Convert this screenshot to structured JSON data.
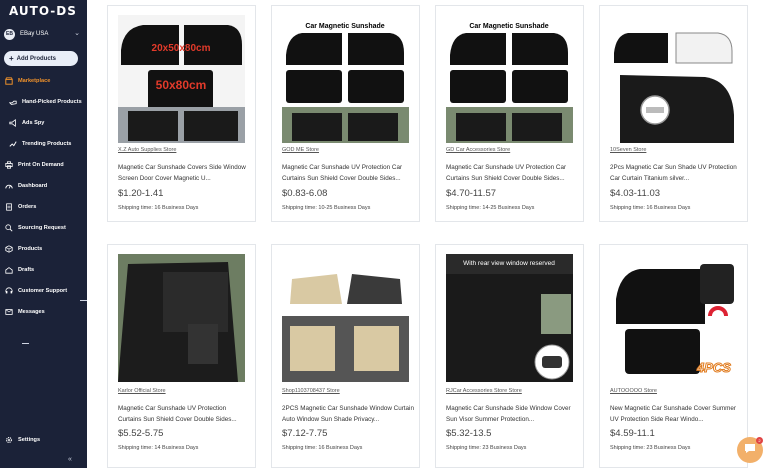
{
  "brand": {
    "logo": "AUTO-DS"
  },
  "store": {
    "badge": "EB",
    "name": "EBay USA"
  },
  "sidebar": {
    "add_products": "Add Products",
    "items": [
      {
        "label": "Marketplace",
        "icon": "store-icon",
        "active": true
      },
      {
        "label": "Hand-Picked Products",
        "icon": "hand-icon",
        "sub": true
      },
      {
        "label": "Ads Spy",
        "icon": "megaphone-icon",
        "sub": true
      },
      {
        "label": "Trending Products",
        "icon": "trend-icon",
        "sub": true
      },
      {
        "label": "Print On Demand",
        "icon": "printer-icon"
      },
      {
        "label": "Dashboard",
        "icon": "dashboard-icon"
      },
      {
        "label": "Orders",
        "icon": "orders-icon"
      },
      {
        "label": "Sourcing Request",
        "icon": "sourcing-icon"
      },
      {
        "label": "Products",
        "icon": "box-icon"
      },
      {
        "label": "Drafts",
        "icon": "drafts-icon"
      },
      {
        "label": "Customer Support",
        "icon": "support-icon"
      },
      {
        "label": "Messages",
        "icon": "mail-icon"
      }
    ],
    "settings": "Settings",
    "collapse": "«"
  },
  "products": [
    {
      "store": "X.Z Auto Supplies Store",
      "title": "Magnetic Car Sunshade Covers Side Window Screen Door Cover Magnetic U...",
      "price": "$1.20-1.41",
      "shipping": "Shipping time: 16 Business Days",
      "image_text": [
        "20x50x80cm",
        "50x80cm"
      ]
    },
    {
      "store": "GOD ME Store",
      "title": "Magnetic Car Sunshade UV Protection Car Curtains Sun Shield Cover Double Sides...",
      "price": "$0.83-6.08",
      "shipping": "Shipping time: 10-25 Business Days",
      "image_text": [
        "Car Magnetic Sunshade"
      ]
    },
    {
      "store": "GD Car Accessories Store",
      "title": "Magnetic Car Sunshade UV Protection Car Curtains Sun Shield Cover Double Sides...",
      "price": "$4.70-11.57",
      "shipping": "Shipping time: 14-25 Business Days",
      "image_text": [
        "Car Magnetic Sunshade"
      ]
    },
    {
      "store": "10Seven Store",
      "title": "2Pcs Magnetic Car Sun Shade UV Protection Car Curtain Titanium silver...",
      "price": "$4.03-11.03",
      "shipping": "Shipping time: 16 Business Days",
      "image_text": []
    },
    {
      "store": "Karlor Official Store",
      "title": "Magnetic Car Sunshade UV Protection Curtains Sun Shield Cover Double Sides...",
      "price": "$5.52-5.75",
      "shipping": "Shipping time: 14 Business Days",
      "image_text": []
    },
    {
      "store": "Shop1103708437 Store",
      "title": "2PCS Magnetic Car Sunshade Window Curtain Auto Window Sun Shade Privacy...",
      "price": "$7.12-7.75",
      "shipping": "Shipping time: 16 Business Days",
      "image_text": []
    },
    {
      "store": "RJCar Accessories Store Store",
      "title": "Magnetic Car Sunshade Side Window Cover Sun Visor Summer Protection...",
      "price": "$5.32-13.5",
      "shipping": "Shipping time: 23 Business Days",
      "image_text": [
        "With rear view window reserved"
      ]
    },
    {
      "store": "AUTOOOOO Store",
      "title": "New Magnetic Car Sunshade Cover Summer UV Protection Side Rear Windo...",
      "price": "$4.59-11.1",
      "shipping": "Shipping time: 23 Business Days",
      "image_text": [
        "4PCS"
      ]
    }
  ],
  "chat": {
    "badge": "2",
    "icon": "chat-icon"
  },
  "colors": {
    "sidebar": "#1b2238",
    "accent": "#f0922b"
  }
}
